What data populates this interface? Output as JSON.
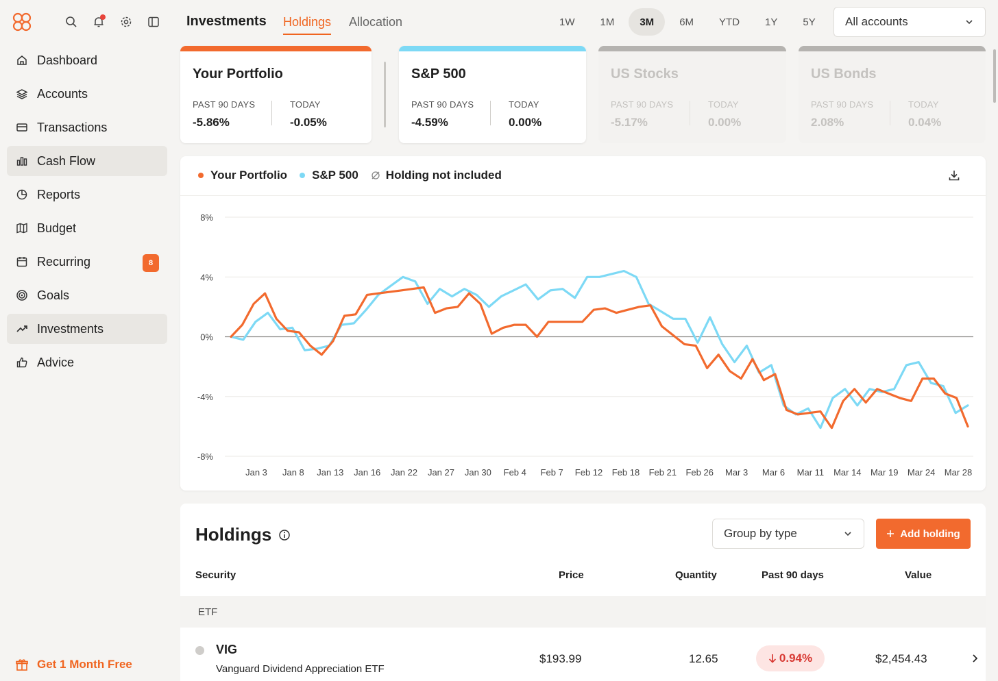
{
  "sidebar": {
    "top_icons": [
      "search-icon",
      "bell-icon",
      "gear-icon",
      "sidebar-toggle-icon"
    ],
    "items": [
      {
        "label": "Dashboard",
        "icon": "home-icon"
      },
      {
        "label": "Accounts",
        "icon": "layers-icon"
      },
      {
        "label": "Transactions",
        "icon": "card-icon"
      },
      {
        "label": "Cash Flow",
        "icon": "bar-chart-icon"
      },
      {
        "label": "Reports",
        "icon": "pie-icon"
      },
      {
        "label": "Budget",
        "icon": "map-icon"
      },
      {
        "label": "Recurring",
        "icon": "calendar-icon",
        "badge": "8"
      },
      {
        "label": "Goals",
        "icon": "target-icon"
      },
      {
        "label": "Investments",
        "icon": "trend-up-icon"
      },
      {
        "label": "Advice",
        "icon": "thumbs-up-icon"
      }
    ],
    "promo": "Get 1 Month Free"
  },
  "header": {
    "title": "Investments",
    "tabs": [
      "Holdings",
      "Allocation"
    ],
    "ranges": [
      "1W",
      "1M",
      "3M",
      "6M",
      "YTD",
      "1Y",
      "5Y"
    ],
    "active_range": "3M",
    "accounts_select": "All accounts"
  },
  "cards": [
    {
      "title": "Your Portfolio",
      "label_a": "PAST 90 DAYS",
      "value_a": "-5.86%",
      "label_b": "TODAY",
      "value_b": "-0.05%",
      "color": "#f26a2e"
    },
    {
      "title": "S&P 500",
      "label_a": "PAST 90 DAYS",
      "value_a": "-4.59%",
      "label_b": "TODAY",
      "value_b": "0.00%",
      "color": "#7dd9f5"
    },
    {
      "title": "US Stocks",
      "label_a": "PAST 90 DAYS",
      "value_a": "-5.17%",
      "label_b": "TODAY",
      "value_b": "0.00%",
      "color": "#b5b3b0"
    },
    {
      "title": "US Bonds",
      "label_a": "PAST 90 DAYS",
      "value_a": "2.08%",
      "label_b": "TODAY",
      "value_b": "0.04%",
      "color": "#b5b3b0"
    }
  ],
  "legend": {
    "portfolio": "Your Portfolio",
    "sp500": "S&P 500",
    "excluded": "Holding not included"
  },
  "chart_data": {
    "type": "line",
    "ylim": [
      -8,
      8
    ],
    "yticks": [
      8,
      4,
      0,
      -4,
      -8
    ],
    "ytick_labels": [
      "8%",
      "4%",
      "0%",
      "-4%",
      "-8%"
    ],
    "xtick_labels": [
      "Jan 3",
      "Jan 8",
      "Jan 13",
      "Jan 16",
      "Jan 22",
      "Jan 27",
      "Jan 30",
      "Feb 4",
      "Feb 7",
      "Feb 12",
      "Feb 18",
      "Feb 21",
      "Feb 26",
      "Mar 3",
      "Mar 6",
      "Mar 11",
      "Mar 14",
      "Mar 19",
      "Mar 24",
      "Mar 28"
    ],
    "series": [
      {
        "name": "Your Portfolio",
        "color": "#f26a2e",
        "values": [
          0.0,
          0.8,
          2.2,
          2.9,
          1.2,
          0.4,
          0.3,
          -0.6,
          -1.2,
          -0.3,
          1.4,
          1.5,
          2.8,
          2.9,
          3.0,
          3.1,
          3.2,
          3.3,
          1.6,
          1.9,
          2.0,
          2.9,
          2.2,
          0.2,
          0.6,
          0.8,
          0.8,
          0.0,
          1.0,
          1.0,
          1.0,
          1.0,
          1.8,
          1.9,
          1.6,
          1.8,
          2.0,
          2.1,
          0.7,
          0.1,
          -0.5,
          -0.6,
          -2.1,
          -1.2,
          -2.3,
          -2.8,
          -1.5,
          -2.9,
          -2.5,
          -4.9,
          -5.2,
          -5.1,
          -5.0,
          -6.1,
          -4.3,
          -3.5,
          -4.4,
          -3.5,
          -3.8,
          -4.1,
          -4.3,
          -2.8,
          -2.8,
          -3.8,
          -4.1,
          -6.0
        ]
      },
      {
        "name": "S&P 500",
        "color": "#7dd9f5",
        "values": [
          0.0,
          -0.2,
          1.0,
          1.6,
          0.5,
          0.6,
          -0.9,
          -0.8,
          -0.6,
          0.8,
          0.9,
          1.8,
          2.8,
          3.4,
          4.0,
          3.7,
          2.2,
          3.2,
          2.7,
          3.2,
          2.8,
          2.0,
          2.7,
          3.1,
          3.5,
          2.5,
          3.1,
          3.2,
          2.6,
          4.0,
          4.0,
          4.2,
          4.4,
          4.0,
          2.2,
          1.7,
          1.2,
          1.2,
          -0.4,
          1.3,
          -0.5,
          -1.7,
          -0.6,
          -2.4,
          -1.9,
          -4.6,
          -5.2,
          -4.8,
          -6.1,
          -4.1,
          -3.5,
          -4.6,
          -3.5,
          -3.7,
          -3.5,
          -1.9,
          -1.7,
          -3.1,
          -3.3,
          -5.1,
          -4.6
        ]
      }
    ]
  },
  "holdings": {
    "title": "Holdings",
    "group_select": "Group by type",
    "add_button": "Add holding",
    "columns": {
      "security": "Security",
      "price": "Price",
      "quantity": "Quantity",
      "past90": "Past 90 days",
      "value": "Value"
    },
    "group_label": "ETF",
    "rows": [
      {
        "symbol": "VIG",
        "name": "Vanguard Dividend Appreciation ETF",
        "price": "$193.99",
        "quantity": "12.65",
        "change": "0.94%",
        "value": "$2,454.43"
      }
    ]
  }
}
